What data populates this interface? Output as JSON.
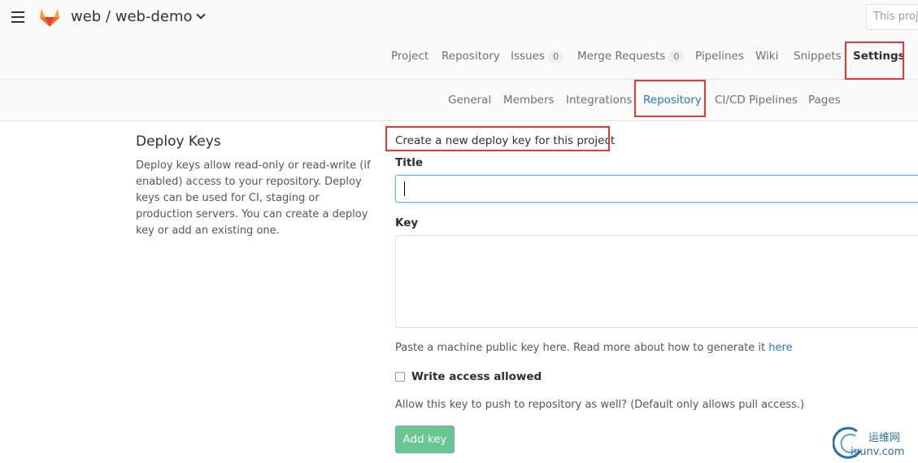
{
  "header": {
    "project_path": "web / web-demo",
    "search_placeholder": "This proj"
  },
  "main_nav": {
    "project": "Project",
    "repository": "Repository",
    "issues": "Issues",
    "issues_count": "0",
    "merge_requests": "Merge Requests",
    "merge_requests_count": "0",
    "pipelines": "Pipelines",
    "wiki": "Wiki",
    "snippets": "Snippets",
    "settings": "Settings"
  },
  "sub_nav": {
    "general": "General",
    "members": "Members",
    "integrations": "Integrations",
    "repository": "Repository",
    "cicd": "CI/CD Pipelines",
    "pages": "Pages"
  },
  "deploy_keys": {
    "heading": "Deploy Keys",
    "description": "Deploy keys allow read-only or read-write (if enabled) access to your repository. Deploy keys can be used for CI, staging or production servers. You can create a deploy key or add an existing one."
  },
  "form": {
    "heading": "Create a new deploy key for this project",
    "title_label": "Title",
    "key_label": "Key",
    "key_help": "Paste a machine public key here. Read more about how to generate it",
    "key_help_link": "here",
    "write_access_label": "Write access allowed",
    "write_access_help": "Allow this key to push to repository as well? (Default only allows pull access.)",
    "submit_label": "Add key"
  },
  "watermark": {
    "line1": "运维网",
    "line2": "iyunv.com"
  },
  "colors": {
    "accent_blue": "#1f78d1",
    "highlight_red": "#e53935",
    "button_green": "#69c891",
    "gitlab_orange": "#e24329"
  }
}
